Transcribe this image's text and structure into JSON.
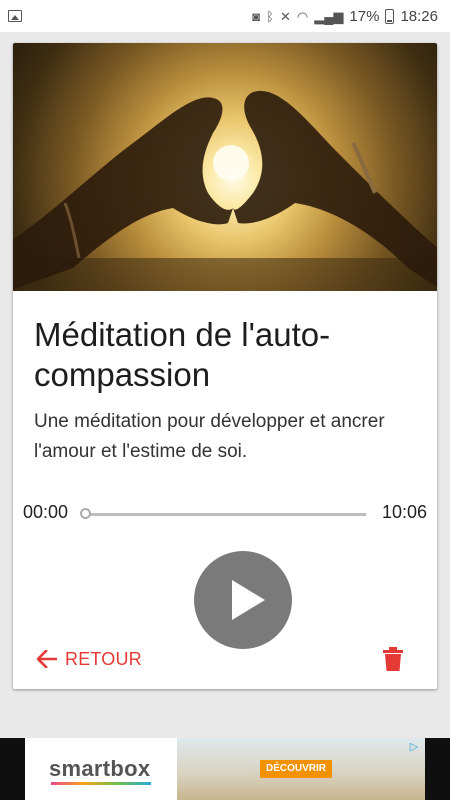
{
  "status_bar": {
    "battery_percent": "17%",
    "time": "18:26",
    "icons": [
      "gallery-icon",
      "headset-icon",
      "bluetooth-icon",
      "mute-icon",
      "wifi-icon",
      "signal-icon",
      "battery-icon"
    ]
  },
  "card": {
    "image": "heart-hands-sunset",
    "title": "Méditation de l'auto-compassion",
    "description": "Une méditation pour développer et ancrer l'amour et l'estime de soi.",
    "player": {
      "current_time": "00:00",
      "duration": "10:06",
      "progress": 0,
      "state": "paused"
    },
    "actions": {
      "back_label": "RETOUR",
      "back_icon": "arrow-left-icon",
      "delete_icon": "trash-icon"
    }
  },
  "ad_banner": {
    "brand": "smartbox",
    "cta_label": "DÉCOUVRIR",
    "adchoices_icon": "adchoices-icon"
  },
  "colors": {
    "accent": "#e53935",
    "play_button": "#7a7a7a",
    "cta": "#f39200"
  }
}
